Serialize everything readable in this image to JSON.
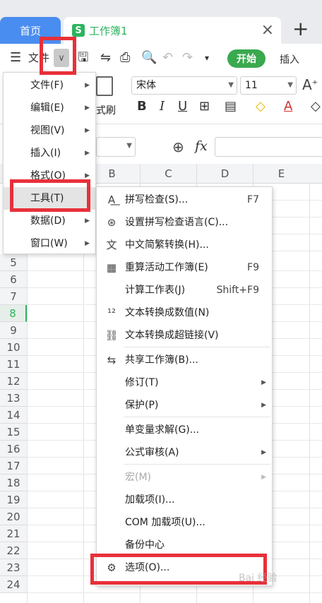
{
  "tabs": {
    "home": "首页",
    "doc_icon": "S",
    "doc_title": "工作簿1",
    "close": "×",
    "new": "+"
  },
  "toolbar": {
    "file_label": "文件",
    "start_label": "开始",
    "insert_label": "插入"
  },
  "ribbon": {
    "font_name": "宋体",
    "font_size": "11",
    "painter_label": "式刷",
    "bold": "B",
    "italic": "I",
    "underline": "U"
  },
  "formula_bar": {
    "fx": "fx"
  },
  "grid": {
    "columns": [
      "B",
      "C",
      "D",
      "E"
    ],
    "rows": [
      "5",
      "6",
      "7",
      "8",
      "9",
      "10",
      "11",
      "12",
      "13",
      "14",
      "15",
      "16",
      "17",
      "18",
      "19",
      "20",
      "21",
      "22",
      "23",
      "24"
    ],
    "active_row": "8"
  },
  "main_menu": [
    {
      "label": "文件(F)",
      "has_sub": true
    },
    {
      "label": "编辑(E)",
      "has_sub": true
    },
    {
      "label": "视图(V)",
      "has_sub": true
    },
    {
      "label": "插入(I)",
      "has_sub": true
    },
    {
      "label": "格式(O)",
      "has_sub": true
    },
    {
      "label": "工具(T)",
      "has_sub": false
    },
    {
      "label": "数据(D)",
      "has_sub": true
    },
    {
      "label": "窗口(W)",
      "has_sub": true
    }
  ],
  "tools_menu": [
    {
      "label": "拼写检查(S)...",
      "shortcut": "F7",
      "icon": "spellcheck-icon"
    },
    {
      "label": "设置拼写检查语言(C)...",
      "shortcut": "",
      "icon": "language-icon"
    },
    {
      "label": "中文简繁转换(H)...",
      "shortcut": "",
      "icon": "chinese-convert-icon"
    },
    {
      "label": "重算活动工作簿(E)",
      "shortcut": "F9",
      "icon": "recalc-icon"
    },
    {
      "label": "计算工作表(J)",
      "shortcut": "Shift+F9",
      "icon": ""
    },
    {
      "label": "文本转换成数值(N)",
      "shortcut": "",
      "icon": "text-to-number-icon"
    },
    {
      "label": "文本转换成超链接(V)",
      "shortcut": "",
      "icon": "text-to-link-icon"
    },
    {
      "label": "共享工作簿(B)...",
      "shortcut": "",
      "icon": "share-workbook-icon"
    },
    {
      "label": "修订(T)",
      "shortcut": "",
      "icon": "",
      "has_sub": true
    },
    {
      "label": "保护(P)",
      "shortcut": "",
      "icon": "",
      "has_sub": true
    },
    {
      "label": "单变量求解(G)...",
      "shortcut": "",
      "icon": ""
    },
    {
      "label": "公式审核(A)",
      "shortcut": "",
      "icon": "",
      "has_sub": true
    },
    {
      "label": "宏(M)",
      "shortcut": "",
      "icon": "",
      "has_sub": true,
      "disabled": true
    },
    {
      "label": "加载项(I)...",
      "shortcut": "",
      "icon": ""
    },
    {
      "label": "COM 加载项(U)...",
      "shortcut": "",
      "icon": ""
    },
    {
      "label": "备份中心",
      "shortcut": "",
      "icon": ""
    },
    {
      "label": "选项(O)...",
      "shortcut": "",
      "icon": "gear-icon"
    }
  ],
  "watermark": "Bai 经验",
  "colors": {
    "accent_green": "#2db45e",
    "home_tab_blue": "#4a8df0",
    "highlight_red": "#e8303a"
  }
}
